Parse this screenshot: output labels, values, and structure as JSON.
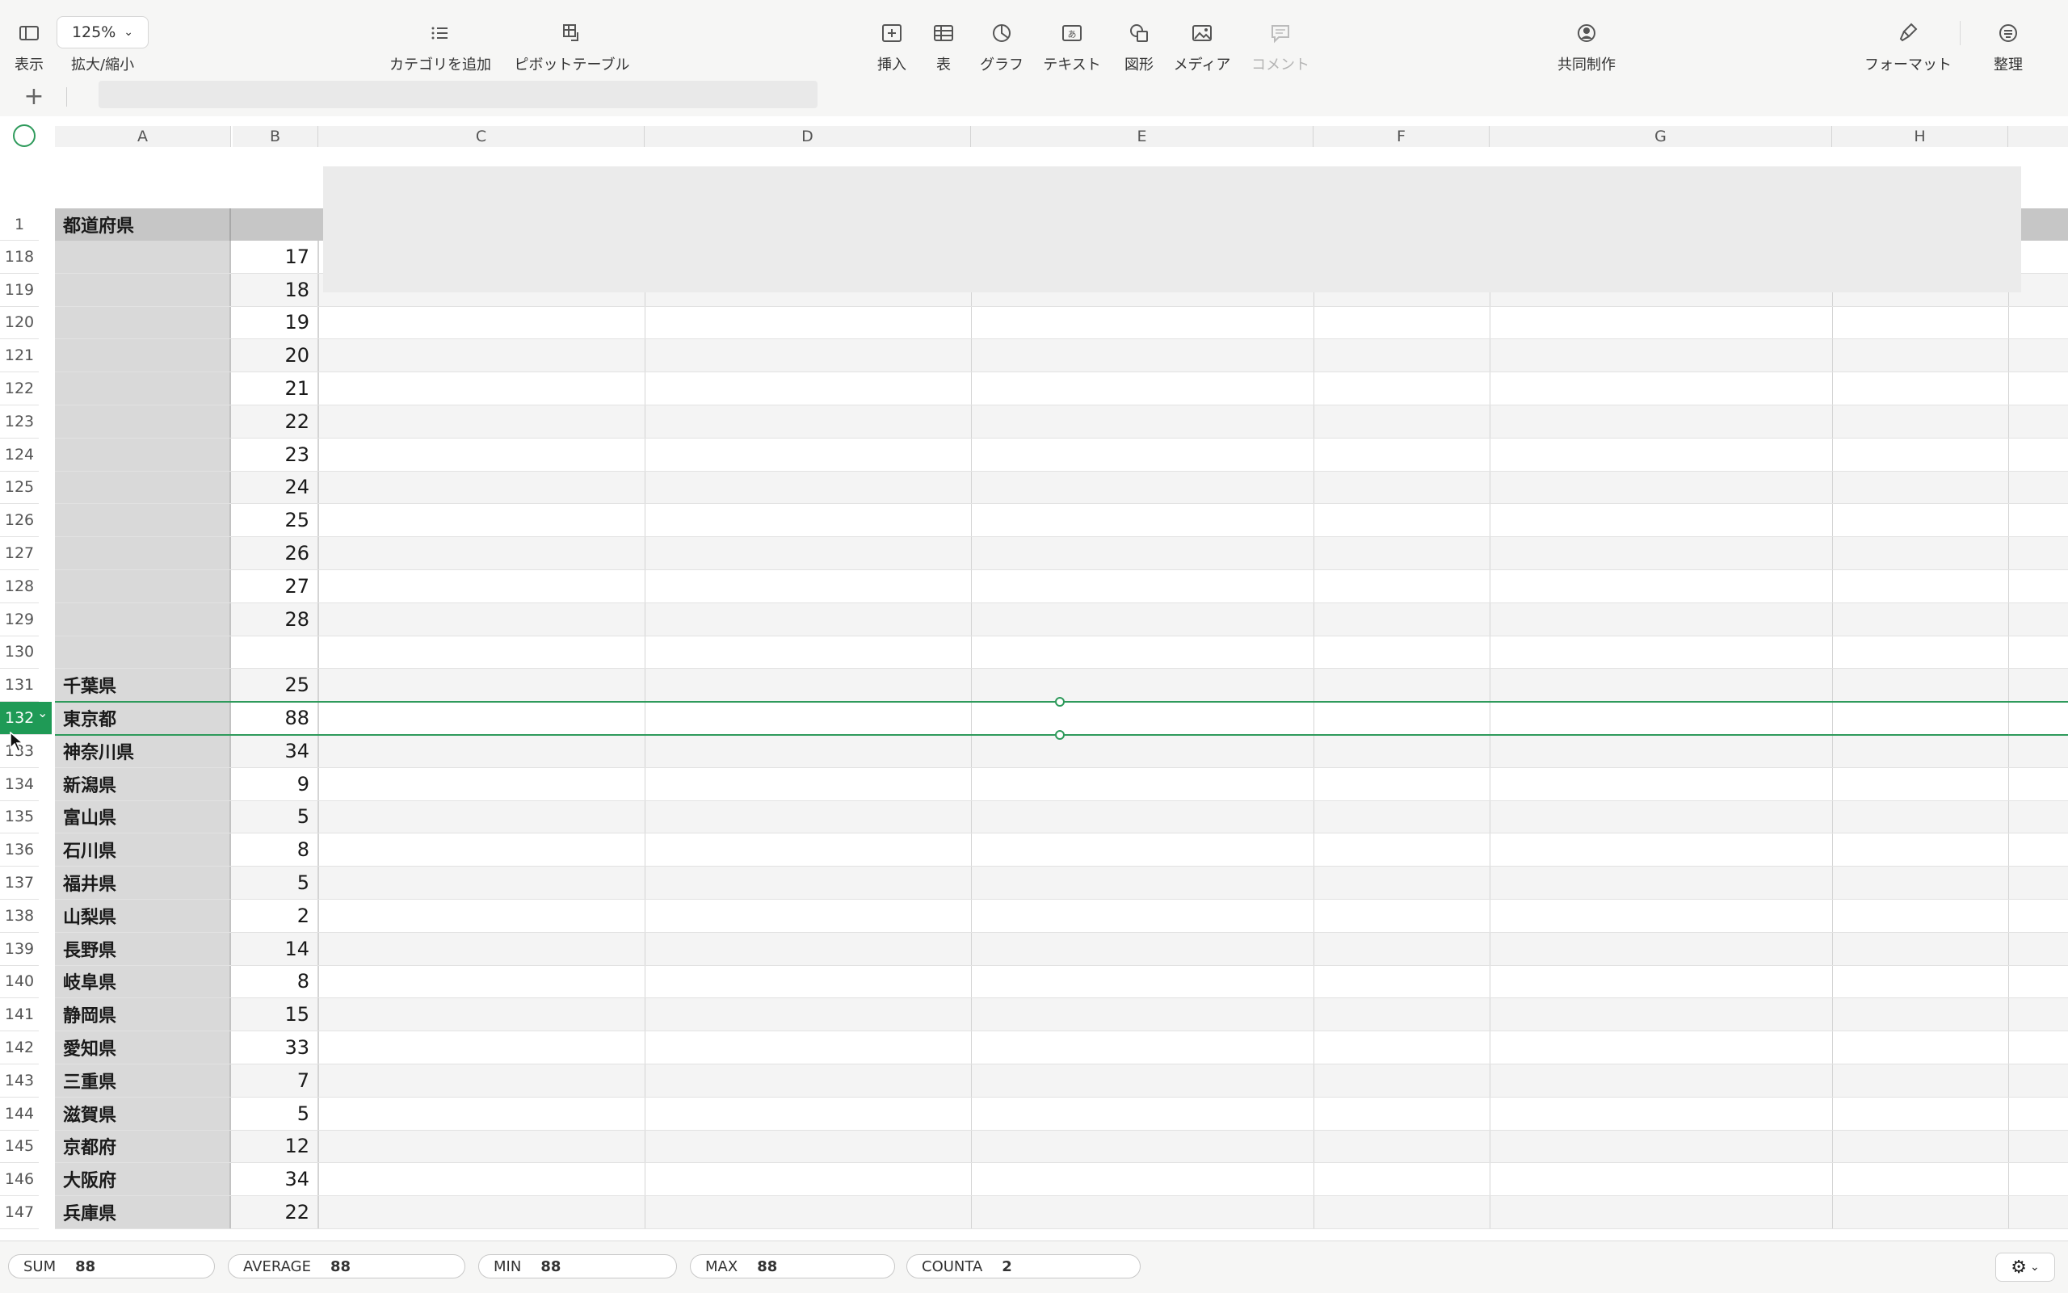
{
  "toolbar": {
    "view_label": "表示",
    "zoom_value": "125%",
    "zoom_label": "拡大/縮小",
    "add_category_label": "カテゴリを追加",
    "pivot_label": "ピボットテーブル",
    "insert_label": "挿入",
    "table_label": "表",
    "chart_label": "グラフ",
    "text_label": "テキスト",
    "shape_label": "図形",
    "media_label": "メディア",
    "comment_label": "コメント",
    "collab_label": "共同制作",
    "format_label": "フォーマット",
    "organize_label": "整理"
  },
  "formula": {
    "add_sheet": "+",
    "value": ""
  },
  "columns": [
    "A",
    "B",
    "C",
    "D",
    "E",
    "F",
    "G",
    "H"
  ],
  "header": {
    "row_num": "1",
    "col_a": "都道府県"
  },
  "rows": [
    {
      "num": "118",
      "a": "",
      "b": "17"
    },
    {
      "num": "119",
      "a": "",
      "b": "18"
    },
    {
      "num": "120",
      "a": "",
      "b": "19"
    },
    {
      "num": "121",
      "a": "",
      "b": "20"
    },
    {
      "num": "122",
      "a": "",
      "b": "21"
    },
    {
      "num": "123",
      "a": "",
      "b": "22"
    },
    {
      "num": "124",
      "a": "",
      "b": "23"
    },
    {
      "num": "125",
      "a": "",
      "b": "24"
    },
    {
      "num": "126",
      "a": "",
      "b": "25"
    },
    {
      "num": "127",
      "a": "",
      "b": "26"
    },
    {
      "num": "128",
      "a": "",
      "b": "27"
    },
    {
      "num": "129",
      "a": "",
      "b": "28"
    },
    {
      "num": "130",
      "a": "",
      "b": ""
    },
    {
      "num": "131",
      "a": "千葉県",
      "b": "25"
    },
    {
      "num": "132",
      "a": "東京都",
      "b": "88"
    },
    {
      "num": "133",
      "a": "神奈川県",
      "b": "34"
    },
    {
      "num": "134",
      "a": "新潟県",
      "b": "9"
    },
    {
      "num": "135",
      "a": "富山県",
      "b": "5"
    },
    {
      "num": "136",
      "a": "石川県",
      "b": "8"
    },
    {
      "num": "137",
      "a": "福井県",
      "b": "5"
    },
    {
      "num": "138",
      "a": "山梨県",
      "b": "2"
    },
    {
      "num": "139",
      "a": "長野県",
      "b": "14"
    },
    {
      "num": "140",
      "a": "岐阜県",
      "b": "8"
    },
    {
      "num": "141",
      "a": "静岡県",
      "b": "15"
    },
    {
      "num": "142",
      "a": "愛知県",
      "b": "33"
    },
    {
      "num": "143",
      "a": "三重県",
      "b": "7"
    },
    {
      "num": "144",
      "a": "滋賀県",
      "b": "5"
    },
    {
      "num": "145",
      "a": "京都府",
      "b": "12"
    },
    {
      "num": "146",
      "a": "大阪府",
      "b": "34"
    },
    {
      "num": "147",
      "a": "兵庫県",
      "b": "22"
    }
  ],
  "selected_row": "132",
  "stats": [
    {
      "key": "SUM",
      "value": "88"
    },
    {
      "key": "AVERAGE",
      "value": "88"
    },
    {
      "key": "MIN",
      "value": "88"
    },
    {
      "key": "MAX",
      "value": "88"
    },
    {
      "key": "COUNTA",
      "value": "2"
    }
  ],
  "colors": {
    "selection": "#2e9a5b",
    "header_fill": "#c6c6c6",
    "col_a_fill": "#d9d9d9"
  }
}
